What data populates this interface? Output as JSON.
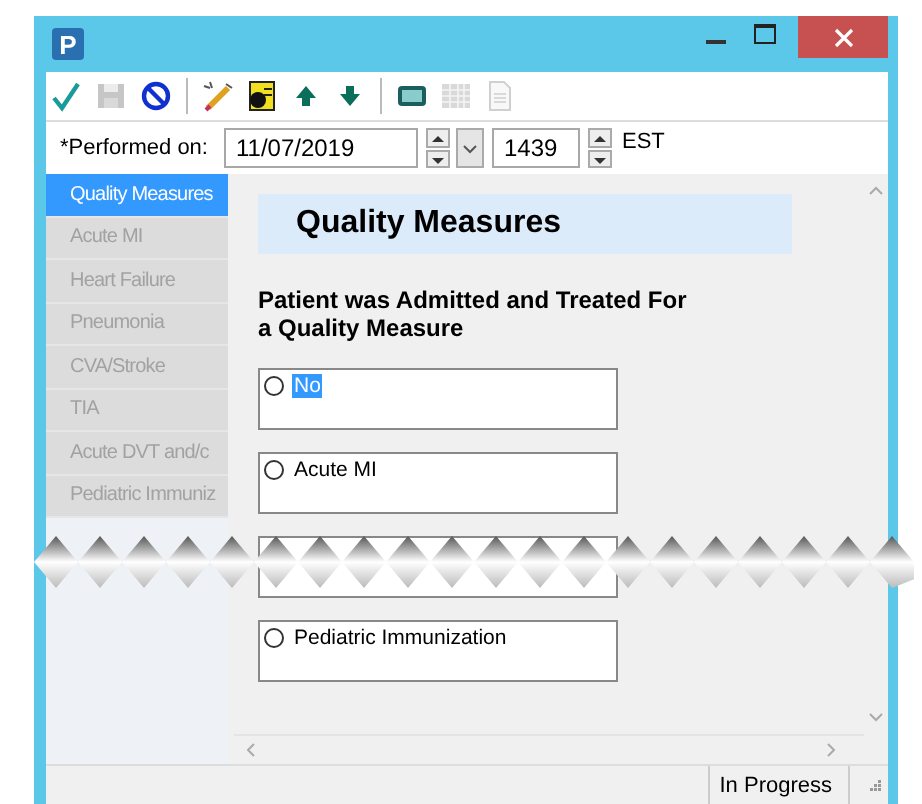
{
  "window": {
    "app_letter": "P"
  },
  "toolbar": [
    {
      "kind": "check",
      "disabled": false
    },
    {
      "kind": "save",
      "disabled": true
    },
    {
      "kind": "cancel",
      "disabled": false
    },
    {
      "kind": "separator"
    },
    {
      "kind": "pencil",
      "disabled": false
    },
    {
      "kind": "card",
      "disabled": false
    },
    {
      "kind": "up",
      "disabled": false
    },
    {
      "kind": "down",
      "disabled": false
    },
    {
      "kind": "separator"
    },
    {
      "kind": "keypad",
      "disabled": false
    },
    {
      "kind": "grid",
      "disabled": true
    },
    {
      "kind": "document",
      "disabled": true
    }
  ],
  "performed_on": {
    "label": "*Performed on:",
    "date": "11/07/2019",
    "time": "1439",
    "zone": "EST"
  },
  "sidebar": {
    "items": [
      {
        "label": "Quality Measures",
        "selected": true
      },
      {
        "label": "Acute MI",
        "selected": false
      },
      {
        "label": "Heart Failure",
        "selected": false
      },
      {
        "label": "Pneumonia",
        "selected": false
      },
      {
        "label": "CVA/Stroke",
        "selected": false
      },
      {
        "label": "TIA",
        "selected": false
      },
      {
        "label": "Acute DVT and/c",
        "selected": false
      },
      {
        "label": "Pediatric Immuniz",
        "selected": false
      }
    ]
  },
  "content": {
    "heading": "Quality Measures",
    "question": "Patient was Admitted and Treated For a Quality Measure",
    "options": [
      {
        "label": "No",
        "checked": false,
        "highlighted": true
      },
      {
        "label": "Acute MI",
        "checked": false,
        "highlighted": false
      },
      {
        "kind": "obscured"
      },
      {
        "label": "Pediatric Immunization",
        "checked": false,
        "highlighted": false
      }
    ]
  },
  "status_bar": {
    "status": "In Progress"
  }
}
